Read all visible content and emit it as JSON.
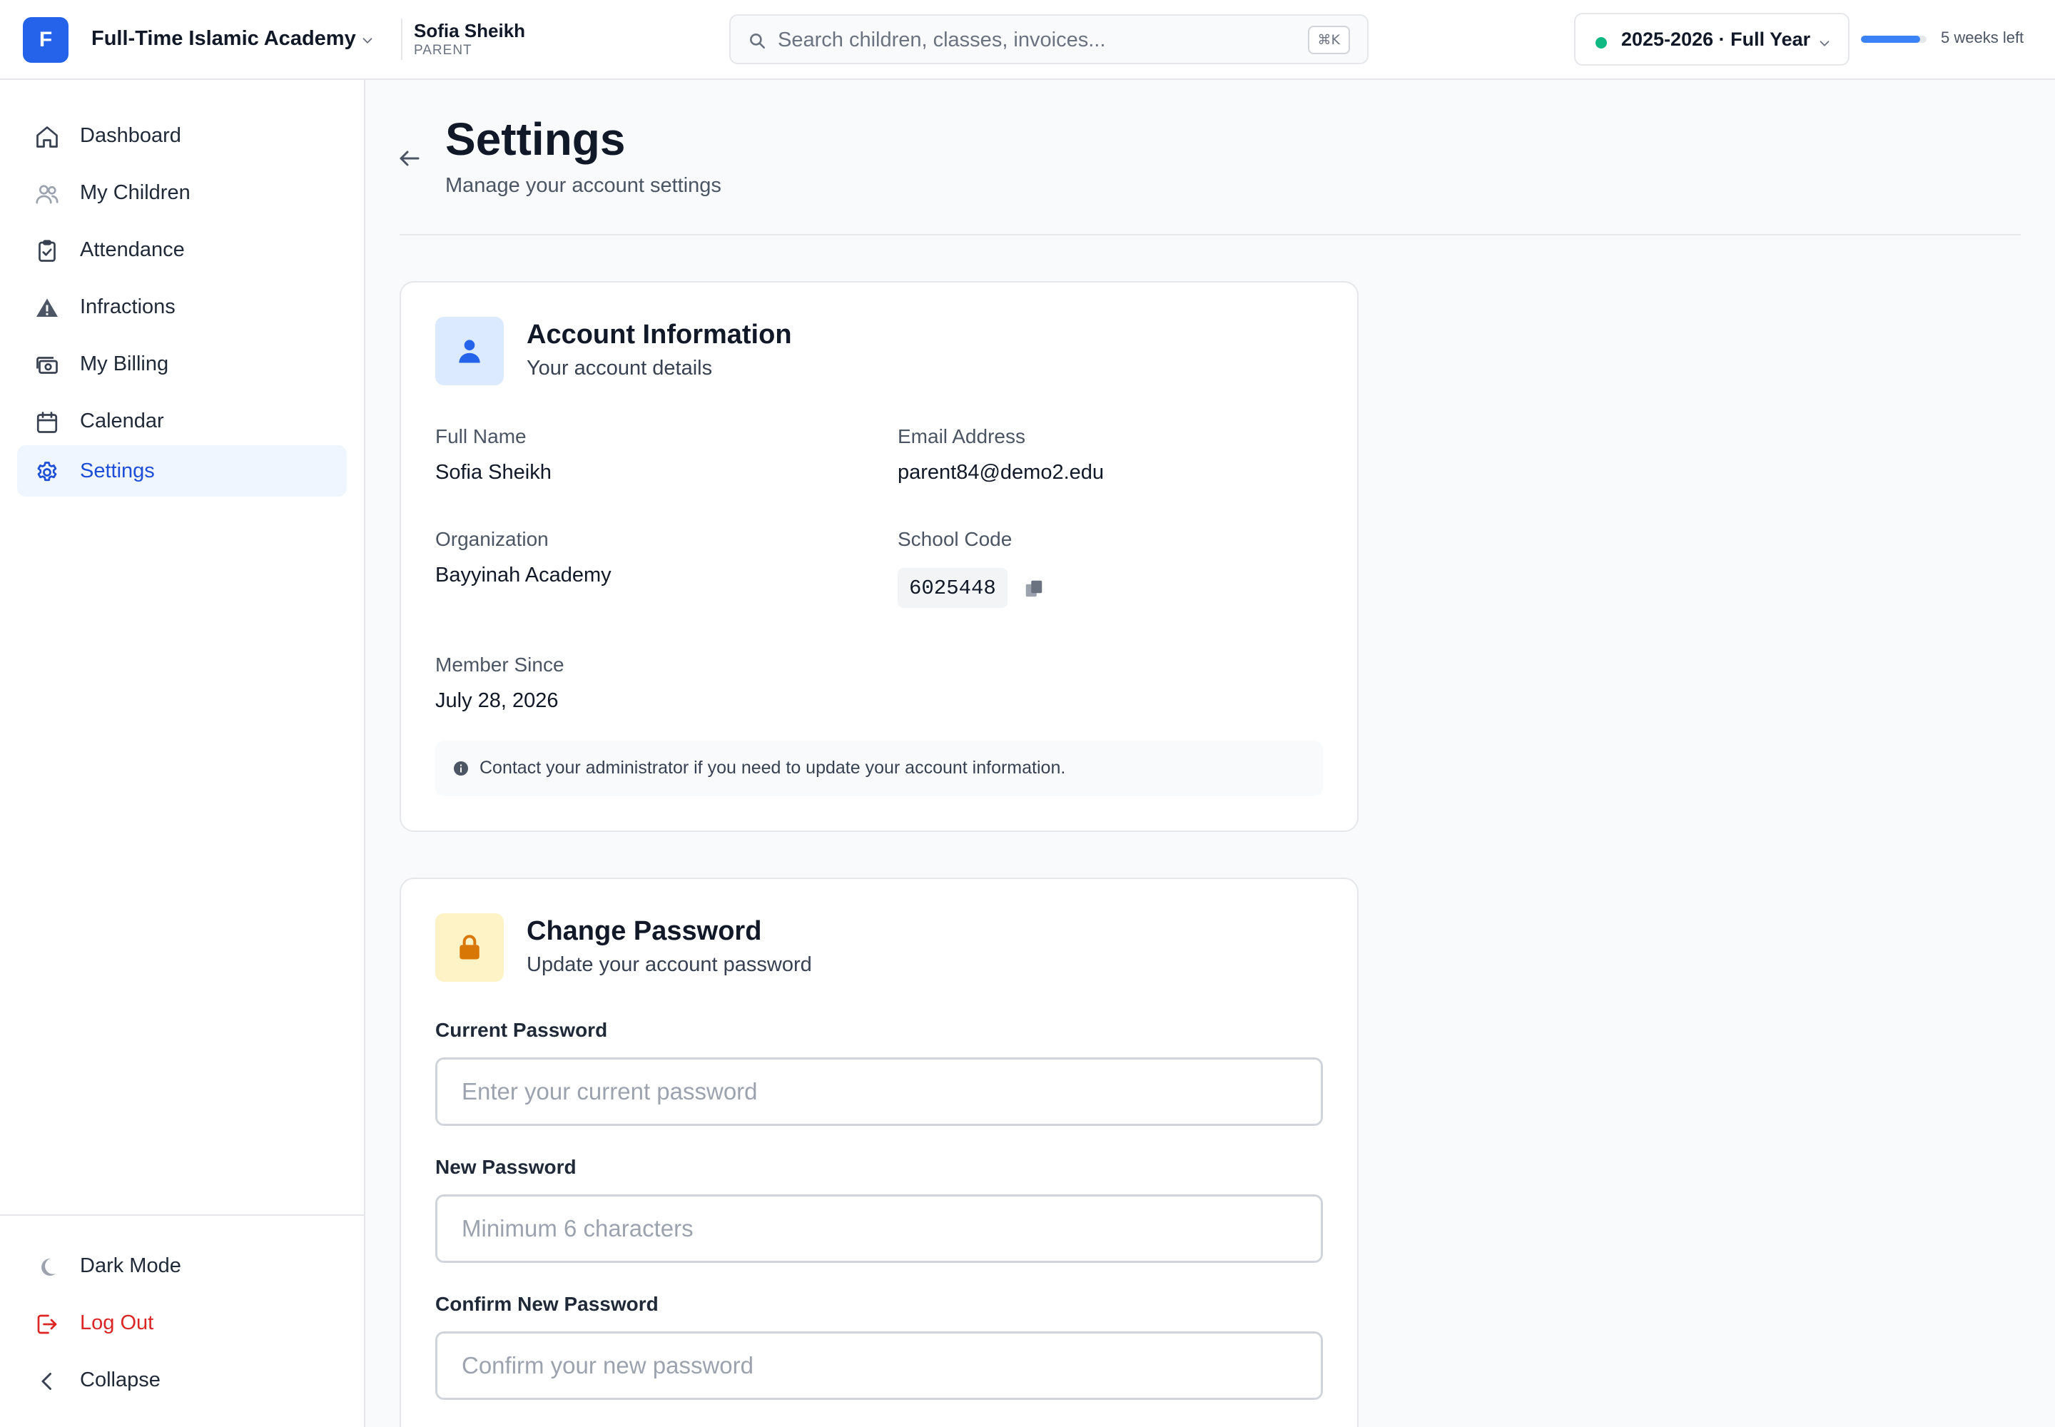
{
  "topbar": {
    "org_initial": "F",
    "org_name": "Full-Time Islamic Academy",
    "user_name": "Sofia Sheikh",
    "user_role": "PARENT",
    "search_placeholder": "Search children, classes, invoices...",
    "search_shortcut": "⌘K",
    "year_label": "2025-2026 · Full Year",
    "weeks_left": "5 weeks left",
    "term_progress_percent": 90
  },
  "sidebar": {
    "items": [
      {
        "label": "Dashboard",
        "icon": "home-icon"
      },
      {
        "label": "My Children",
        "icon": "users-icon"
      },
      {
        "label": "Attendance",
        "icon": "clipboard-check-icon"
      },
      {
        "label": "Infractions",
        "icon": "warning-icon"
      },
      {
        "label": "My Billing",
        "icon": "billing-icon"
      },
      {
        "label": "Calendar",
        "icon": "calendar-icon"
      },
      {
        "label": "Settings",
        "icon": "gear-icon",
        "active": true
      }
    ],
    "bottom": {
      "dark_mode": "Dark Mode",
      "logout": "Log Out",
      "collapse": "Collapse"
    }
  },
  "page": {
    "title": "Settings",
    "subtitle": "Manage your account settings"
  },
  "account": {
    "title": "Account Information",
    "subtitle": "Your account details",
    "full_name_label": "Full Name",
    "full_name": "Sofia Sheikh",
    "email_label": "Email Address",
    "email": "parent84@demo2.edu",
    "org_label": "Organization",
    "org": "Bayyinah Academy",
    "school_code_label": "School Code",
    "school_code": "6025448",
    "member_since_label": "Member Since",
    "member_since": "July 28, 2026",
    "note": "Contact your administrator if you need to update your account information."
  },
  "password": {
    "title": "Change Password",
    "subtitle": "Update your account password",
    "current_label": "Current Password",
    "current_placeholder": "Enter your current password",
    "new_label": "New Password",
    "new_placeholder": "Minimum 6 characters",
    "confirm_label": "Confirm New Password",
    "confirm_placeholder": "Confirm your new password"
  },
  "colors": {
    "accent": "#2563eb",
    "active_bg": "#eff6ff",
    "danger": "#dc2626",
    "status_green": "#10b981",
    "lock_amber": "#d97706"
  }
}
